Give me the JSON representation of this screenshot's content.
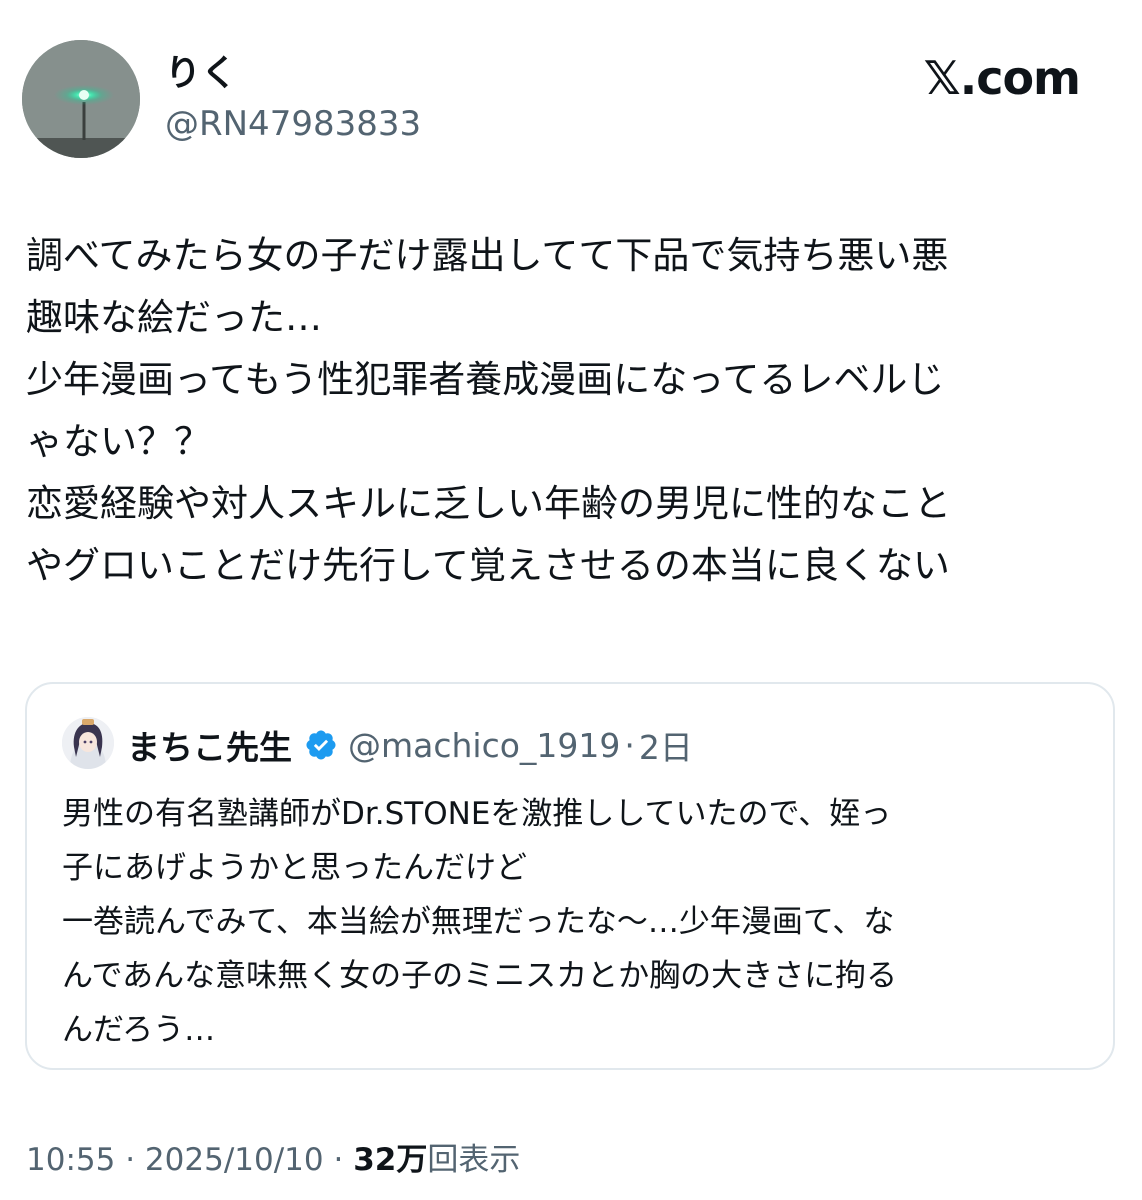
{
  "author": {
    "display_name": "りく",
    "handle": "@RN47983833",
    "avatar_icon": "green-light-avatar-icon"
  },
  "brand": {
    "label": "𝕏.com"
  },
  "tweet": {
    "lines": [
      "調べてみたら女の子だけ露出してて下品で気持ち悪い悪",
      "趣味な絵だった…",
      "少年漫画ってもう性犯罪者養成漫画になってるレベルじ",
      "ゃない？？",
      "恋愛経験や対人スキルに乏しい年齢の男児に性的なこと",
      "やグロいことだけ先行して覚えさせるの本当に良くない"
    ]
  },
  "quote": {
    "display_name": "まちこ先生",
    "verified_icon": "verified-badge-icon",
    "verified_color": "#1d9bf0",
    "handle": "@machico_1919",
    "separator": "·",
    "time": "2日",
    "lines": [
      "男性の有名塾講師がDr.STONEを激推ししていたので、姪っ",
      "子にあげようかと思ったんだけど",
      "一巻読んでみて、本当絵が無理だったな〜…少年漫画て、な",
      "んであんな意味無く女の子のミニスカとか胸の大きさに拘る",
      "んだろう…"
    ]
  },
  "meta": {
    "time": "10:55",
    "sep1": "·",
    "date": "2025/10/10",
    "sep2": "·",
    "views_count": "32万",
    "views_label": "回表示"
  }
}
